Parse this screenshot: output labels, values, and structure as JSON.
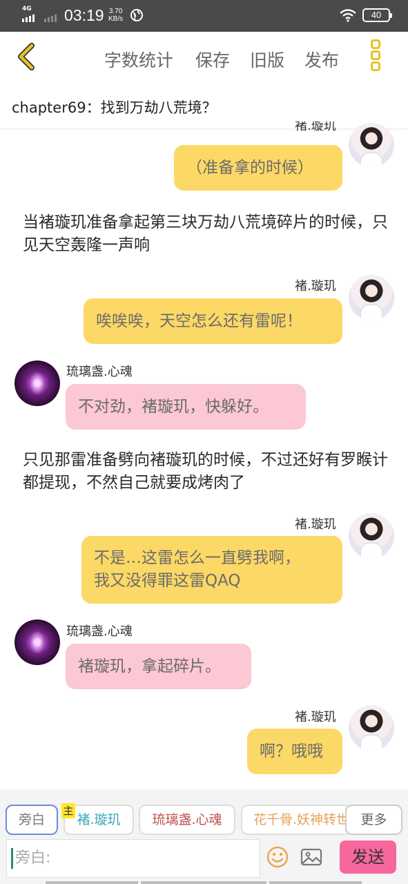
{
  "status": {
    "network": "4G",
    "time": "03:19",
    "speed_value": "3.70",
    "speed_unit": "KB/s",
    "battery": "40"
  },
  "header": {
    "back_icon": "chevron-left-icon",
    "menu": [
      "字数统计",
      "保存",
      "旧版",
      "发布"
    ],
    "more_icon": "more-vertical-icon",
    "accent": "#e7c129"
  },
  "chapter_title": "chapter69：找到万劫八荒境？",
  "chat": {
    "m1": {
      "name": "褚.璇玑",
      "text": "（准备拿的时候）"
    },
    "n1": "当褚璇玑准备拿起第三块万劫八荒境碎片的时候，只见天空轰隆一声响",
    "m2": {
      "name": "褚.璇玑",
      "text": "唉唉唉，天空怎么还有雷呢！"
    },
    "m3": {
      "name": "琉璃盏.心魂",
      "text": "不对劲，褚璇玑，快躲好。"
    },
    "n2": "只见那雷准备劈向褚璇玑的时候，不过还好有罗睺计都提现，不然自己就要成烤肉了",
    "m4": {
      "name": "褚.璇玑",
      "line1": "不是…这雷怎么一直劈我啊，",
      "line2": "我又没得罪这雷QAQ"
    },
    "m5": {
      "name": "琉璃盏.心魂",
      "text": "褚璇玑，拿起碎片。"
    },
    "m6": {
      "name": "褚.璇玑",
      "text": "啊？哦哦"
    },
    "colors": {
      "own_bubble": "#fcd866",
      "other_bubble": "#fbc8d4"
    }
  },
  "bottom": {
    "chips": [
      {
        "label": "旁白",
        "color": "#777777"
      },
      {
        "label": "褚.璇玑",
        "color": "#3aa7b8"
      },
      {
        "label": "琉璃盏.心魂",
        "color": "#c0504d"
      },
      {
        "label": "花千骨.妖神转世",
        "color": "#e8a05a"
      }
    ],
    "main_badge": "主",
    "more_label": "更多",
    "input_placeholder": "旁白:",
    "emoji_icon": "smiley-icon",
    "image_icon": "image-icon",
    "send_label": "发送",
    "send_color": "#f5679d"
  }
}
